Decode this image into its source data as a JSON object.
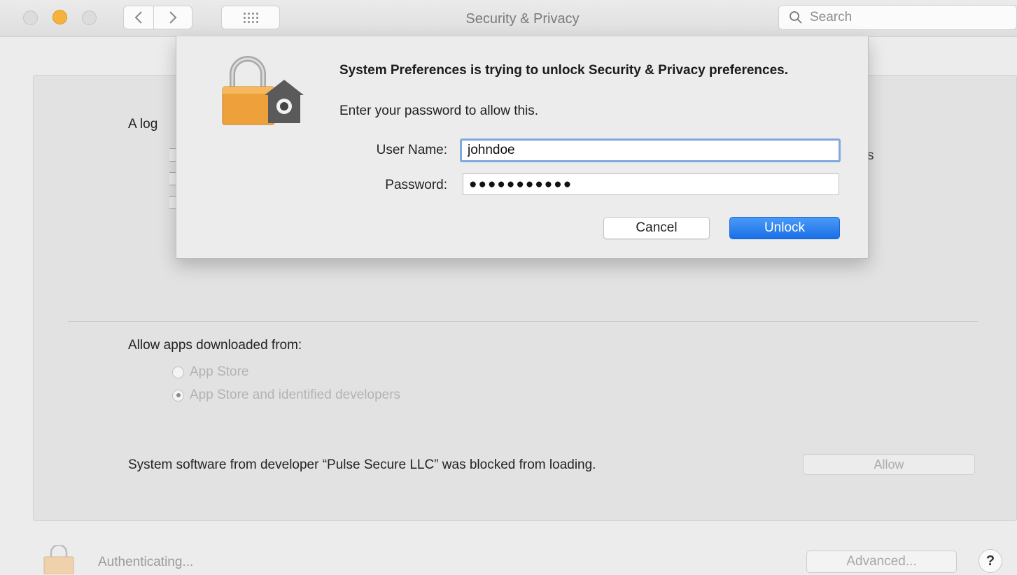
{
  "window": {
    "title": "Security & Privacy"
  },
  "toolbar": {
    "back_icon": "chevron-left-icon",
    "forward_icon": "chevron-right-icon",
    "grid_icon": "grid-icon",
    "search_placeholder": "Search"
  },
  "panel": {
    "login_label_partial": "A log",
    "trailing_fragment": "s",
    "allow_apps_label": "Allow apps downloaded from:",
    "options": [
      {
        "label": "App Store",
        "selected": false
      },
      {
        "label": "App Store and identified developers",
        "selected": true
      }
    ],
    "blocked_message": "System software from developer “Pulse Secure LLC” was blocked from loading.",
    "allow_button": "Allow"
  },
  "footer": {
    "status": "Authenticating...",
    "advanced_button": "Advanced...",
    "help_button": "?"
  },
  "dialog": {
    "title": "System Preferences is trying to unlock Security & Privacy preferences.",
    "message": "Enter your password to allow this.",
    "user_name_label": "User Name:",
    "user_name_value": "johndoe",
    "password_label": "Password:",
    "password_mask": "●●●●●●●●●●●",
    "cancel_button": "Cancel",
    "unlock_button": "Unlock"
  }
}
